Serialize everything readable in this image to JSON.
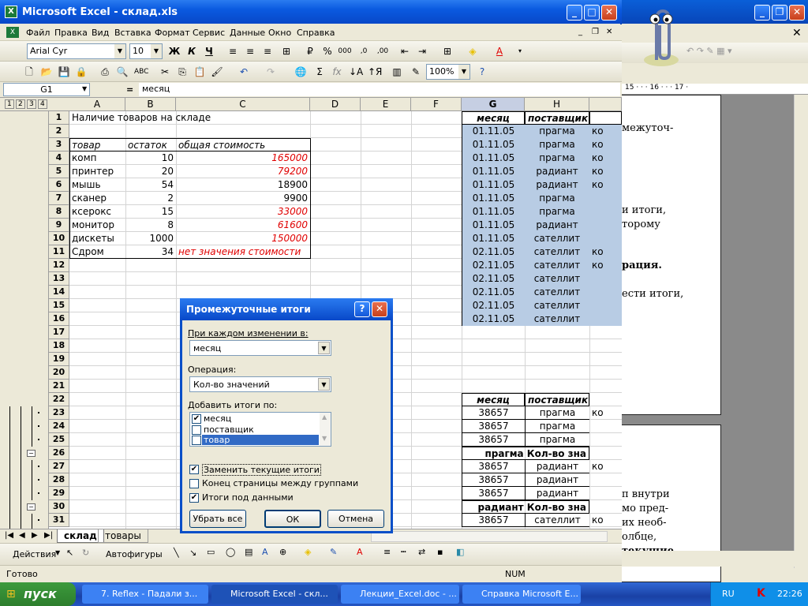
{
  "excel": {
    "title": "Microsoft Excel - склад.xls",
    "menu": [
      "Файл",
      "Правка",
      "Вид",
      "Вставка",
      "Формат",
      "Сервис",
      "Данные",
      "Окно",
      "Справка"
    ],
    "font_name": "Arial Cyr",
    "font_size": "10",
    "zoom": "100%",
    "name_box": "G1",
    "formula_eq": "=",
    "formula_value": "месяц",
    "outline_levels": [
      "1",
      "2",
      "3",
      "4"
    ],
    "columns": [
      "A",
      "B",
      "C",
      "D",
      "E",
      "F",
      "G",
      "H"
    ],
    "selected_column": "G",
    "rows": [
      "1",
      "2",
      "3",
      "4",
      "5",
      "6",
      "7",
      "8",
      "9",
      "10",
      "11",
      "12",
      "13",
      "14",
      "15",
      "16",
      "17",
      "18",
      "19",
      "20",
      "21",
      "22",
      "23",
      "24",
      "25",
      "26",
      "27",
      "28",
      "29",
      "30",
      "31"
    ],
    "left_table": {
      "title": "Наличие товаров на складе",
      "headers": [
        "товар",
        "остаток",
        "общая стоимость"
      ],
      "rows": [
        [
          "комп",
          "10",
          "165000"
        ],
        [
          "принтер",
          "20",
          "79200"
        ],
        [
          "мышь",
          "54",
          "18900"
        ],
        [
          "сканер",
          "2",
          "9900"
        ],
        [
          "ксерокс",
          "15",
          "33000"
        ],
        [
          "монитор",
          "8",
          "61600"
        ],
        [
          "дискеты",
          "1000",
          "150000"
        ],
        [
          "Сдром",
          "34",
          "нет значения стоимости"
        ]
      ],
      "red_rows": [
        0,
        1,
        4,
        5,
        6,
        7
      ]
    },
    "right_table_top": {
      "headers": [
        "месяц",
        "поставщик"
      ],
      "g_values": [
        "01.11.05",
        "01.11.05",
        "01.11.05",
        "01.11.05",
        "01.11.05",
        "01.11.05",
        "01.11.05",
        "01.11.05",
        "01.11.05",
        "02.11.05",
        "02.11.05",
        "02.11.05",
        "02.11.05",
        "02.11.05",
        "02.11.05"
      ],
      "h_values": [
        "прагма",
        "прагма",
        "прагма",
        "радиант",
        "радиант",
        "прагма",
        "прагма",
        "радиант",
        "сателлит",
        "сателлит",
        "сателлит",
        "сателлит",
        "сателлит",
        "сателлит",
        "сателлит"
      ],
      "i_values": [
        "ко",
        "ко",
        "ко",
        "ко",
        "ко",
        "",
        "",
        "",
        "",
        "ко",
        "ко",
        "",
        "",
        "",
        ""
      ]
    },
    "right_table_bottom": {
      "headers": [
        "месяц",
        "поставщик"
      ],
      "rows": [
        {
          "g": "38657",
          "h": "прагма",
          "i": "ко"
        },
        {
          "g": "38657",
          "h": "прагма",
          "i": ""
        },
        {
          "g": "38657",
          "h": "прагма",
          "i": ""
        },
        {
          "total": "прагма Кол-во зна"
        },
        {
          "g": "38657",
          "h": "радиант",
          "i": "ко"
        },
        {
          "g": "38657",
          "h": "радиант",
          "i": ""
        },
        {
          "g": "38657",
          "h": "радиант",
          "i": ""
        },
        {
          "total": "радиант Кол-во зна"
        },
        {
          "g": "38657",
          "h": "сателлит",
          "i": "ко"
        }
      ]
    },
    "sheet_tabs": [
      "склад",
      "товары"
    ],
    "active_tab": "склад",
    "draw_actions": "Действия",
    "autoshapes": "Автофигуры",
    "status_left": "Готово",
    "status_num": "NUM"
  },
  "dialog": {
    "title": "Промежуточные итоги",
    "help": "?",
    "close": "✕",
    "label_change": "При каждом изменении в:",
    "change_value": "месяц",
    "label_operation": "Операция:",
    "operation_value": "Кол-во значений",
    "label_add": "Добавить итоги по:",
    "fields": [
      {
        "label": "месяц",
        "checked": true
      },
      {
        "label": "поставщик",
        "checked": false
      },
      {
        "label": "товар",
        "checked": false
      }
    ],
    "opt_replace": "Заменить текущие итоги",
    "opt_pagebreak": "Конец страницы между группами",
    "opt_below": "Итоги под данными",
    "btn_remove": "Убрать все",
    "btn_ok": "ОК",
    "btn_cancel": "Отмена"
  },
  "word": {
    "ruler": "15 · · · 16 · · · 17 ·",
    "lines_top": [
      "межуточ-",
      "и итоги,",
      "торому",
      "рация.",
      "ести итоги,"
    ],
    "lines_bottom": [
      "п внутри",
      "мо пред-",
      "их необ-",
      "олбце,",
      "текущие"
    ]
  },
  "taskbar": {
    "start": "пуск",
    "tasks": [
      "7. Reflex - Падали з...",
      "Microsoft Excel - скл...",
      "Лекции_Excel.doc - ...",
      "Справка Microsoft E..."
    ],
    "lang": "RU",
    "time": "22:26"
  }
}
